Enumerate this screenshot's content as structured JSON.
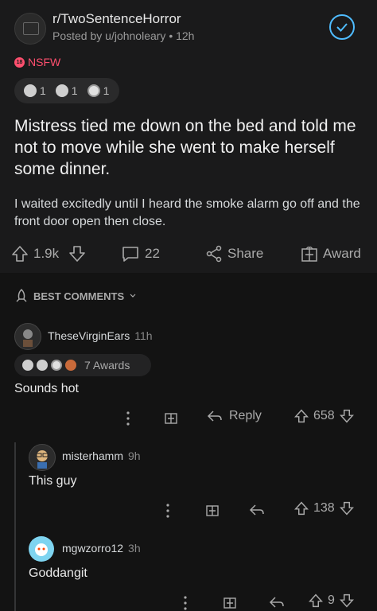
{
  "post": {
    "subreddit": "r/TwoSentenceHorror",
    "posted_by": "Posted by u/johnoleary • 12h",
    "nsfw_badge": "18",
    "nsfw_label": "NSFW",
    "awards": [
      {
        "icon": "award-silver-icon",
        "count": "1"
      },
      {
        "icon": "award-wholesome-icon",
        "count": "1"
      },
      {
        "icon": "award-s-icon",
        "count": "1"
      }
    ],
    "title": "Mistress tied me down on the bed and told me not to move while she went to make herself some dinner.",
    "body": "I waited excitedly until I heard the smoke alarm go off and the front door open then close.",
    "upvotes": "1.9k",
    "comments": "22",
    "share_label": "Share",
    "award_label": "Award"
  },
  "sort": {
    "label": "BEST COMMENTS"
  },
  "comments": [
    {
      "username": "TheseVirginEars",
      "time": "11h",
      "awards_label": "7 Awards",
      "text": "Sounds hot",
      "reply_label": "Reply",
      "votes": "658"
    },
    {
      "username": "misterhamm",
      "time": "9h",
      "text": "This guy",
      "votes": "138"
    },
    {
      "username": "mgwzorro12",
      "time": "3h",
      "text": "Goddangit",
      "votes": "9"
    }
  ],
  "colors": {
    "accent": "#4fbcff",
    "nsfw": "#ff4f6e",
    "background": "#131313",
    "card": "#1a1a1b"
  }
}
